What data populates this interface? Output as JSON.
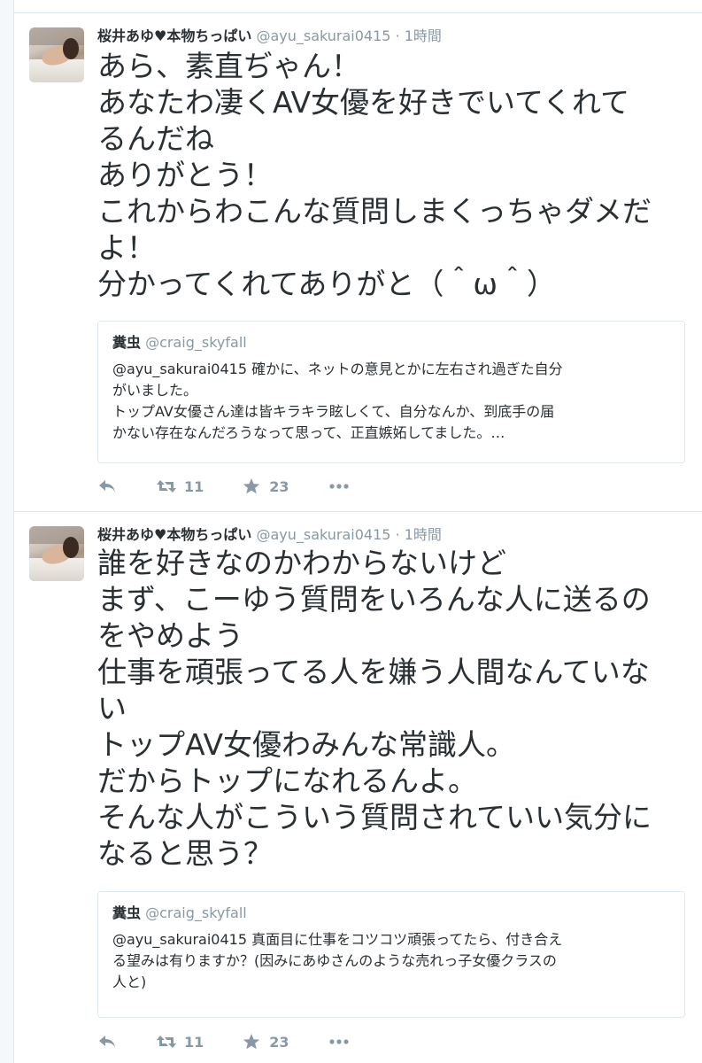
{
  "tweets": [
    {
      "author_name": "桜井あゆ♥本物ちっぱい",
      "handle": "@ayu_sakurai0415",
      "separator": "·",
      "time": "1時間",
      "lines": [
        "あら、素直ぢゃん！",
        "あなたわ凄くAV女優を好きでいてくれて",
        "るんだね",
        "ありがとう！",
        "これからわこんな質問しまくっちゃダメだ",
        "よ！",
        "分かってくれてありがと（＾ω＾）"
      ],
      "quote": {
        "name": "糞虫",
        "handle": "@craig_skyfall",
        "lines": [
          "@ayu_sakurai0415 確かに、ネットの意見とかに左右され過ぎた自分",
          "がいました。",
          "トップAV女優さん達は皆キラキラ眩しくて、自分なんか、到底手の届",
          "かない存在なんだろうなって思って、正直嫉妬してました。…"
        ]
      },
      "retweets": "11",
      "favorites": "23"
    },
    {
      "author_name": "桜井あゆ♥本物ちっぱい",
      "handle": "@ayu_sakurai0415",
      "separator": "·",
      "time": "1時間",
      "lines": [
        "誰を好きなのかわからないけど",
        "まず、こーゆう質問をいろんな人に送るの",
        "をやめよう",
        "仕事を頑張ってる人を嫌う人間なんていな",
        "い",
        "トップAV女優わみんな常識人。",
        "だからトップになれるんよ。",
        "そんな人がこういう質問されていい気分に",
        "なると思う？"
      ],
      "quote": {
        "name": "糞虫",
        "handle": "@craig_skyfall",
        "lines": [
          "@ayu_sakurai0415 真面目に仕事をコツコツ頑張ってたら、付き合え",
          "る望みは有りますか？(因みにあゆさんのような売れっ子女優クラスの",
          "人と)"
        ]
      },
      "retweets": "11",
      "favorites": "23"
    }
  ],
  "icons": {
    "reply": "reply-icon",
    "retweet": "retweet-icon",
    "favorite": "star-icon",
    "more": "more-icon"
  },
  "colors": {
    "text": "#292f33",
    "secondary": "#8899a6",
    "border": "#e1e8ed"
  }
}
